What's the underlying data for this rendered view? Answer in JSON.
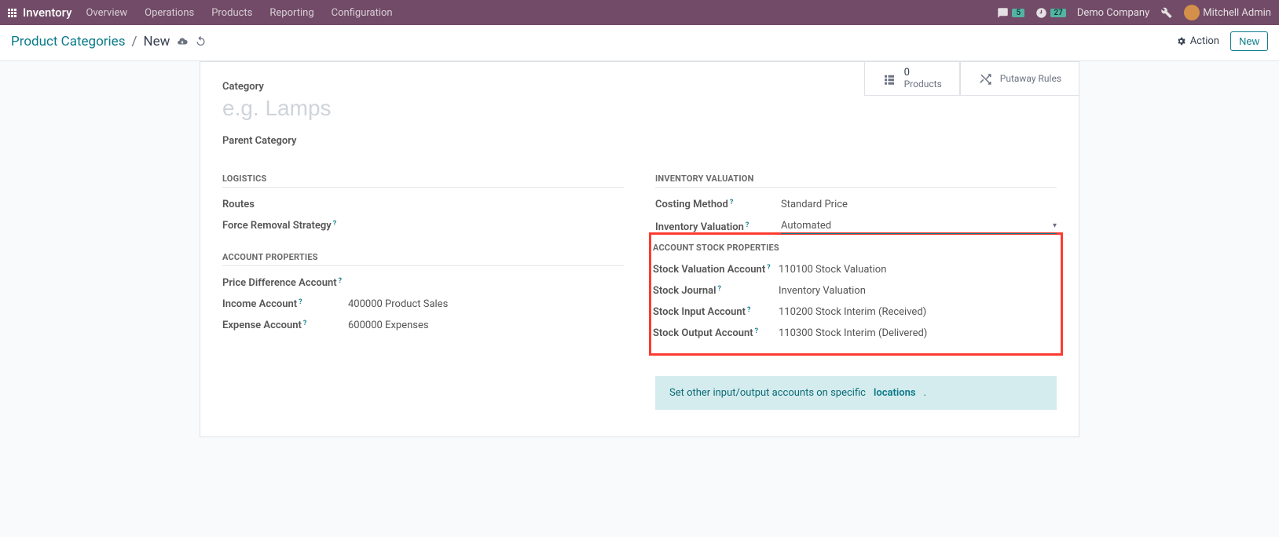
{
  "navbar": {
    "brand": "Inventory",
    "menu": [
      "Overview",
      "Operations",
      "Products",
      "Reporting",
      "Configuration"
    ],
    "messages_badge": "5",
    "activity_badge": "27",
    "company": "Demo Company",
    "user": "Mitchell Admin"
  },
  "breadcrumb": {
    "root": "Product Categories",
    "current": "New",
    "action_label": "Action",
    "new_label": "New"
  },
  "stat_buttons": {
    "products_count": "0",
    "products_label": "Products",
    "putaway_label": "Putaway Rules"
  },
  "form": {
    "category_label": "Category",
    "category_placeholder": "e.g. Lamps",
    "parent_category_label": "Parent Category",
    "sections": {
      "logistics": {
        "title": "Logistics",
        "routes_label": "Routes",
        "removal_label": "Force Removal Strategy"
      },
      "account_props": {
        "title": "Account Properties",
        "price_diff_label": "Price Difference Account",
        "income_label": "Income Account",
        "income_value": "400000 Product Sales",
        "expense_label": "Expense Account",
        "expense_value": "600000 Expenses"
      },
      "inv_val": {
        "title": "Inventory Valuation",
        "costing_label": "Costing Method",
        "costing_value": "Standard Price",
        "invval_label": "Inventory Valuation",
        "invval_value": "Automated"
      },
      "stock_props": {
        "title": "Account Stock Properties",
        "valuation_label": "Stock Valuation Account",
        "valuation_value": "110100 Stock Valuation",
        "journal_label": "Stock Journal",
        "journal_value": "Inventory Valuation",
        "input_label": "Stock Input Account",
        "input_value": "110200 Stock Interim (Received)",
        "output_label": "Stock Output Account",
        "output_value": "110300 Stock Interim (Delivered)"
      }
    },
    "info_text": "Set other input/output accounts on specific",
    "info_link": "locations",
    "info_dot": "."
  }
}
